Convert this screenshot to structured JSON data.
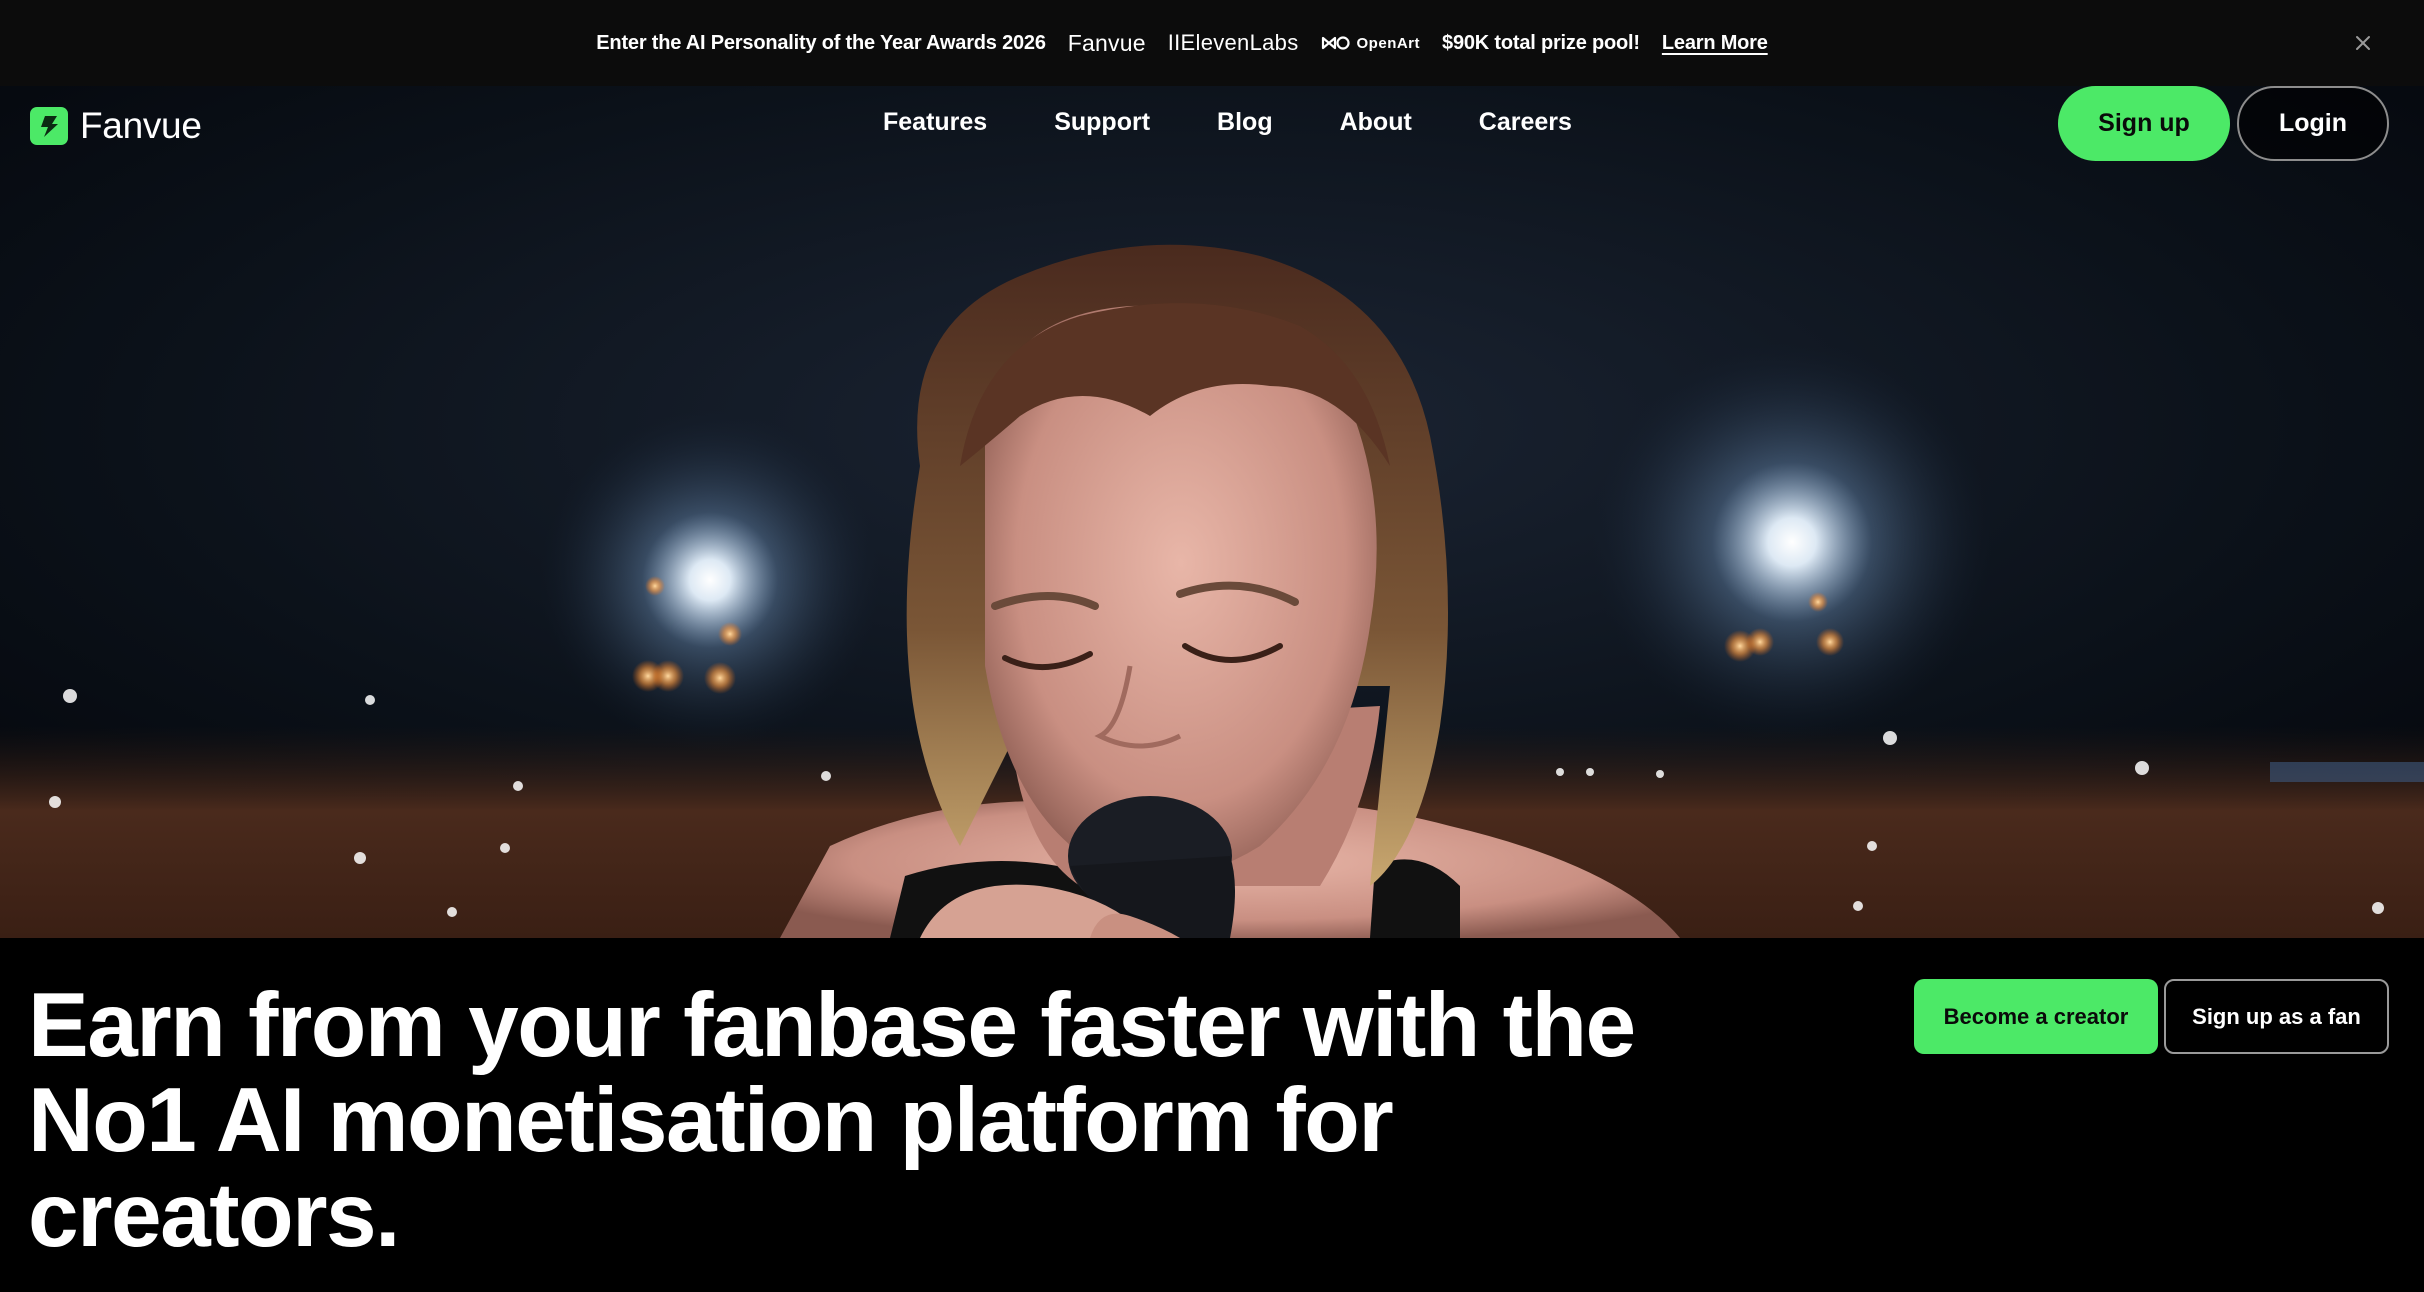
{
  "announcement": {
    "text": "Enter the AI Personality of the Year Awards 2026",
    "sponsors": [
      "Fanvue",
      "IIElevenLabs",
      "OpenArt"
    ],
    "prize": "$90K total prize pool!",
    "link_label": "Learn More",
    "close_icon": "close-icon"
  },
  "nav": {
    "logo_text": "Fanvue",
    "logo_icon": "fanvue-bolt-icon",
    "links": [
      "Features",
      "Support",
      "Blog",
      "About",
      "Careers"
    ],
    "signup_label": "Sign up",
    "login_label": "Login"
  },
  "hero": {
    "image_description": "singer-with-microphone-stadium-lights"
  },
  "main": {
    "headline": "Earn from your fanbase faster with the No1 AI monetisation platform for creators.",
    "creator_button": "Become a creator",
    "fan_button": "Sign up as a fan"
  },
  "colors": {
    "accent": "#4ce967",
    "background": "#000000",
    "announcement_bg": "#0c0c0c"
  }
}
